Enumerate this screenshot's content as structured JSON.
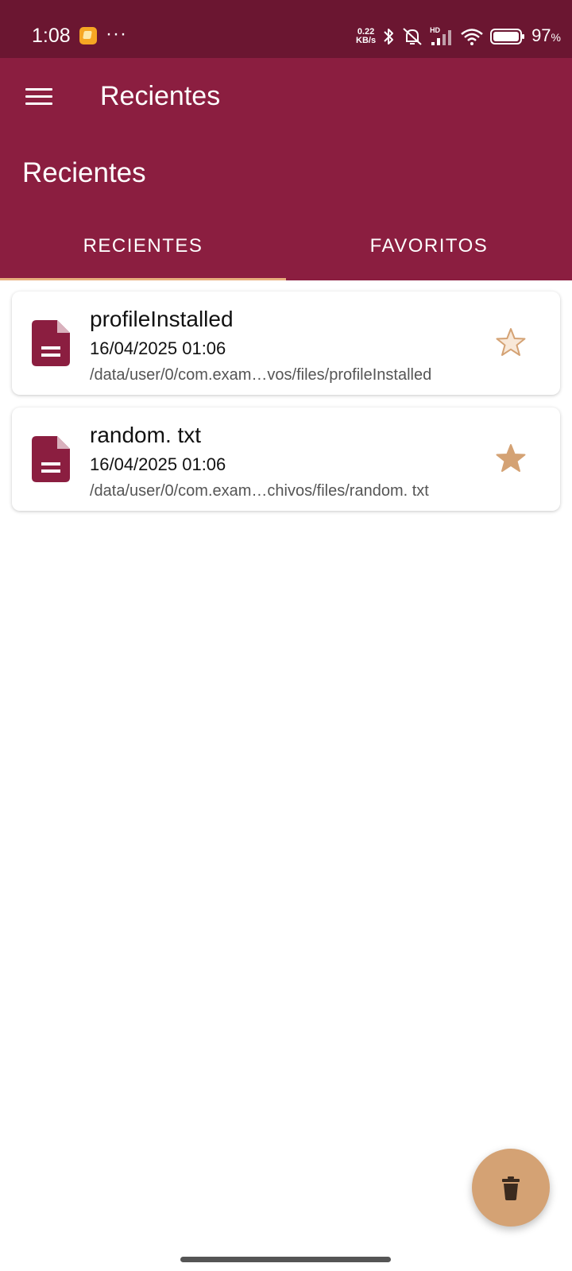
{
  "status_bar": {
    "time": "1:08",
    "dots": "···",
    "speed_value": "0.22",
    "speed_unit": "KB/s",
    "network_label": "HD",
    "battery_percent": "97",
    "battery_percent_sign": "%"
  },
  "app_bar": {
    "toolbar_title": "Recientes",
    "large_title": "Recientes"
  },
  "tabs": [
    {
      "label": "RECIENTES",
      "active": true
    },
    {
      "label": "FAVORITOS",
      "active": false
    }
  ],
  "files": [
    {
      "name": "profileInstalled",
      "date": "16/04/2025 01:06",
      "path": "/data/user/0/com.exam…vos/files/profileInstalled",
      "favorite": false
    },
    {
      "name": "random. txt",
      "date": "16/04/2025 01:06",
      "path": "/data/user/0/com.exam…chivos/files/random. txt",
      "favorite": true
    }
  ],
  "colors": {
    "status_bar": "#6b1631",
    "primary": "#8b1e40",
    "accent": "#d4a274",
    "tab_indicator": "#e8b07e",
    "star_filled": "#d4a274",
    "star_empty_fill": "#f8e8d8"
  },
  "icons": {
    "menu": "menu-icon",
    "file": "document-icon",
    "favorite": "star-icon",
    "fab": "trash-icon"
  }
}
